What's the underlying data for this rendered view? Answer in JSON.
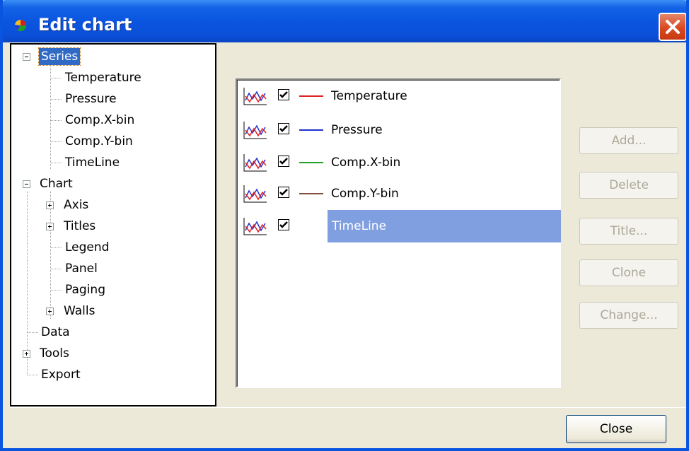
{
  "window": {
    "title": "Edit chart"
  },
  "tree": {
    "series_label": "Series",
    "series_items": [
      "Temperature",
      "Pressure",
      "Comp.X-bin",
      "Comp.Y-bin",
      "TimeLine"
    ],
    "chart_label": "Chart",
    "chart_items": [
      "Axis",
      "Titles",
      "Legend",
      "Panel",
      "Paging",
      "Walls"
    ],
    "data_label": "Data",
    "tools_label": "Tools",
    "export_label": "Export"
  },
  "series_list": [
    {
      "name": "Temperature",
      "color": "#e02020",
      "checked": true
    },
    {
      "name": "Pressure",
      "color": "#2030d0",
      "checked": true
    },
    {
      "name": "Comp.X-bin",
      "color": "#20a020",
      "checked": true
    },
    {
      "name": "Comp.Y-bin",
      "color": "#805040",
      "checked": true
    },
    {
      "name": "TimeLine",
      "color": "",
      "checked": true,
      "selected": true
    }
  ],
  "buttons": {
    "add": "Add...",
    "delete": "Delete",
    "title": "Title...",
    "clone": "Clone",
    "change": "Change...",
    "close": "Close"
  },
  "colors": {
    "titlebar": "#0a55e0",
    "selection": "#316ac5",
    "list_selection": "#7f9fe0"
  }
}
